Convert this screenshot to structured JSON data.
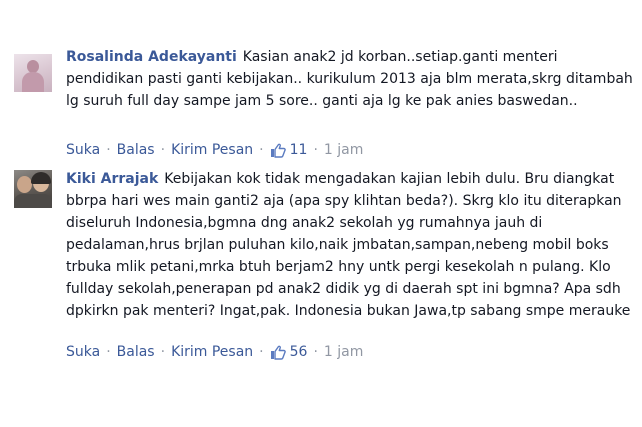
{
  "comments": [
    {
      "author": "Rosalinda Adekayanti",
      "text": "Kasian anak2 jd korban..setiap.ganti menteri pendidikan pasti ganti kebijakan.. kurikulum 2013 aja blm merata,skrg ditambah lg suruh full day sampe jam 5 sore.. ganti aja lg ke pak anies baswedan..",
      "actions": {
        "like": "Suka",
        "reply": "Balas",
        "send": "Kirim Pesan",
        "like_count": "11",
        "time": "1 jam"
      }
    },
    {
      "author": "Kiki Arrajak",
      "text": "Kebijakan kok tidak mengadakan kajian lebih dulu. Bru diangkat bbrpa hari wes main ganti2 aja (apa spy klihtan beda?). Skrg klo itu diterapkan diseluruh Indonesia,bgmna dng anak2 sekolah yg rumahnya jauh di pedalaman,hrus brjlan puluhan kilo,naik jmbatan,sampan,nebeng mobil boks trbuka mlik petani,mrka btuh berjam2 hny untk pergi kesekolah n pulang. Klo fullday sekolah,penerapan pd anak2 didik yg di daerah spt ini bgmna? Apa sdh dpkirkn pak menteri? Ingat,pak. Indonesia bukan Jawa,tp sabang smpe merauke",
      "actions": {
        "like": "Suka",
        "reply": "Balas",
        "send": "Kirim Pesan",
        "like_count": "56",
        "time": "1 jam"
      }
    }
  ],
  "colors": {
    "link": "#3b5998",
    "text": "#141823",
    "meta": "#9197a3"
  },
  "icons": {
    "like": "thumbs-up-icon"
  }
}
